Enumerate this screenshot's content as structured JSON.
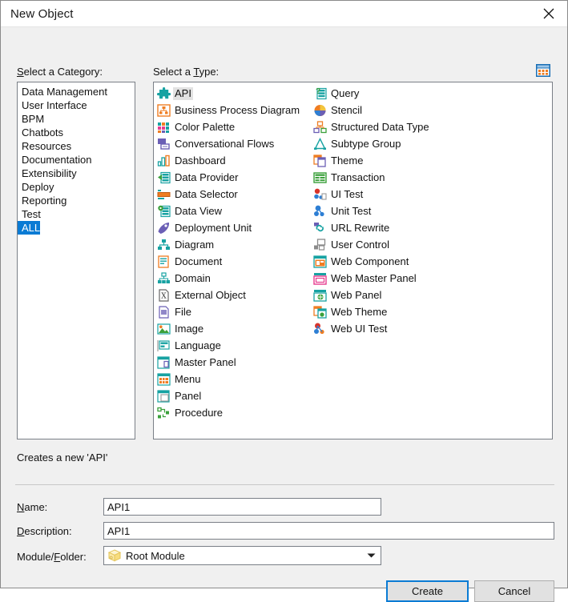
{
  "window": {
    "title": "New Object",
    "close_icon": "close-icon"
  },
  "headers": {
    "category": "Select a Category:",
    "category_mnemonic": "S",
    "type": "Select a Type:",
    "type_mnemonic": "T",
    "view_toggle_icon": "large-icons-view-icon"
  },
  "categories": {
    "items": [
      {
        "label": "Data Management",
        "selected": false
      },
      {
        "label": "User Interface",
        "selected": false
      },
      {
        "label": "BPM",
        "selected": false
      },
      {
        "label": "Chatbots",
        "selected": false
      },
      {
        "label": "Resources",
        "selected": false
      },
      {
        "label": "Documentation",
        "selected": false
      },
      {
        "label": "Extensibility",
        "selected": false
      },
      {
        "label": "Deploy",
        "selected": false
      },
      {
        "label": "Reporting",
        "selected": false
      },
      {
        "label": "Test",
        "selected": false
      },
      {
        "label": "ALL",
        "selected": true
      }
    ],
    "selected_value": "ALL"
  },
  "types": {
    "selected_value": "API",
    "items": [
      {
        "label": "API",
        "icon": "api-puzzle-icon",
        "selected": true
      },
      {
        "label": "Business Process Diagram",
        "icon": "bpd-hierarchy-icon",
        "selected": false
      },
      {
        "label": "Color Palette",
        "icon": "color-palette-icon",
        "selected": false
      },
      {
        "label": "Conversational Flows",
        "icon": "conversational-flows-icon",
        "selected": false
      },
      {
        "label": "Dashboard",
        "icon": "dashboard-bars-icon",
        "selected": false
      },
      {
        "label": "Data Provider",
        "icon": "data-provider-icon",
        "selected": false
      },
      {
        "label": "Data Selector",
        "icon": "data-selector-icon",
        "selected": false
      },
      {
        "label": "Data View",
        "icon": "data-view-icon",
        "selected": false
      },
      {
        "label": "Deployment Unit",
        "icon": "deployment-unit-icon",
        "selected": false
      },
      {
        "label": "Diagram",
        "icon": "diagram-icon",
        "selected": false
      },
      {
        "label": "Document",
        "icon": "document-icon",
        "selected": false
      },
      {
        "label": "Domain",
        "icon": "domain-icon",
        "selected": false
      },
      {
        "label": "External Object",
        "icon": "external-object-icon",
        "selected": false
      },
      {
        "label": "File",
        "icon": "file-icon",
        "selected": false
      },
      {
        "label": "Image",
        "icon": "image-icon",
        "selected": false
      },
      {
        "label": "Language",
        "icon": "language-icon",
        "selected": false
      },
      {
        "label": "Master Panel",
        "icon": "master-panel-icon",
        "selected": false
      },
      {
        "label": "Menu",
        "icon": "menu-icon",
        "selected": false
      },
      {
        "label": "Panel",
        "icon": "panel-icon",
        "selected": false
      },
      {
        "label": "Procedure",
        "icon": "procedure-icon",
        "selected": false
      },
      {
        "label": "Query",
        "icon": "query-icon",
        "selected": false
      },
      {
        "label": "Stencil",
        "icon": "stencil-icon",
        "selected": false
      },
      {
        "label": "Structured Data Type",
        "icon": "structured-data-type-icon",
        "selected": false
      },
      {
        "label": "Subtype Group",
        "icon": "subtype-group-icon",
        "selected": false
      },
      {
        "label": "Theme",
        "icon": "theme-icon",
        "selected": false
      },
      {
        "label": "Transaction",
        "icon": "transaction-icon",
        "selected": false
      },
      {
        "label": "UI Test",
        "icon": "ui-test-icon",
        "selected": false
      },
      {
        "label": "Unit Test",
        "icon": "unit-test-icon",
        "selected": false
      },
      {
        "label": "URL Rewrite",
        "icon": "url-rewrite-icon",
        "selected": false
      },
      {
        "label": "User Control",
        "icon": "user-control-icon",
        "selected": false
      },
      {
        "label": "Web Component",
        "icon": "web-component-icon",
        "selected": false
      },
      {
        "label": "Web Master Panel",
        "icon": "web-master-panel-icon",
        "selected": false
      },
      {
        "label": "Web Panel",
        "icon": "web-panel-icon",
        "selected": false
      },
      {
        "label": "Web Theme",
        "icon": "web-theme-icon",
        "selected": false
      },
      {
        "label": "Web UI Test",
        "icon": "web-ui-test-icon",
        "selected": false
      }
    ]
  },
  "description": "Creates a new 'API'",
  "form": {
    "name_label": "Name:",
    "name_mnemonic": "N",
    "name_value": "API1",
    "description_label": "Description:",
    "description_mnemonic": "D",
    "description_value": "API1",
    "module_label": "Module/Folder:",
    "module_mnemonic": "F",
    "module_value": "Root Module",
    "module_icon": "module-box-icon",
    "module_arrow_icon": "chevron-down-icon"
  },
  "footer": {
    "create_label": "Create",
    "cancel_label": "Cancel"
  },
  "colors": {
    "accent": "#0a7bd4",
    "selection_blue": "#0a7bd4",
    "dialog_bg": "#f0f0f0",
    "teal": "#17a2a2",
    "orange": "#ef7d22",
    "green": "#3aa03a"
  }
}
